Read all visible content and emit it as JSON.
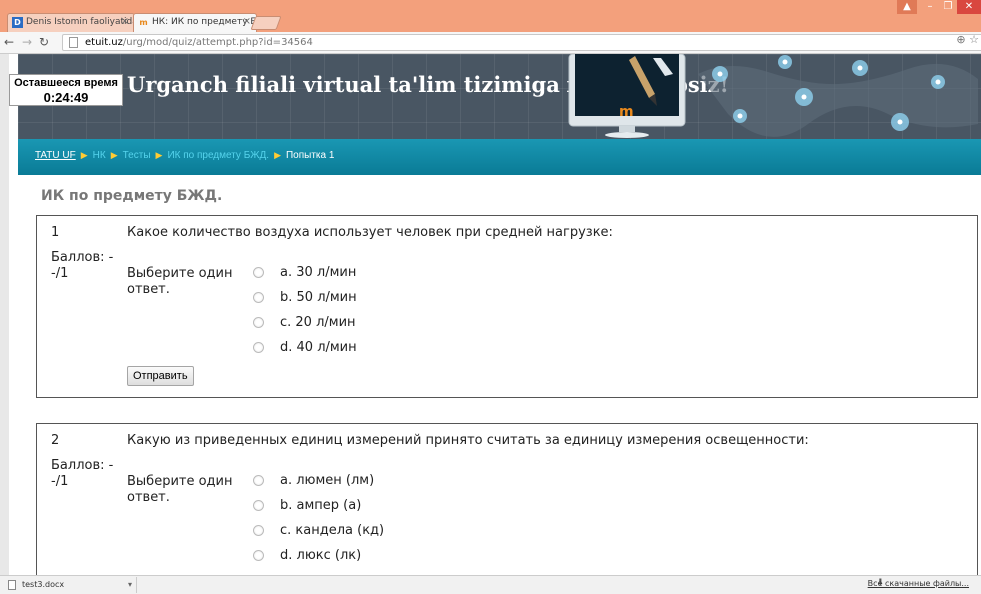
{
  "browser": {
    "tabs": [
      {
        "favicon": "D",
        "title": "Denis Istomin faoliyatida",
        "active": false
      },
      {
        "favicon": "m",
        "title": "НК: ИК по предмету БЖД",
        "active": true
      }
    ],
    "url_host": "etuit.uz",
    "url_path": "/urg/mod/quiz/attempt.php?id=34564"
  },
  "header": {
    "site_title": "Urganch filiali virtual ta'lim tizimiga xush kelibsiz!",
    "timer_label": "Оставшееся время",
    "timer_value": "0:24:49"
  },
  "breadcrumb": [
    "TATU UF",
    "НК",
    "Тесты",
    "ИК по предмету БЖД.",
    "Попытка 1"
  ],
  "quiz_title": "ИК по предмету БЖД.",
  "questions": [
    {
      "number": "1",
      "grade": "Баллов: --/1",
      "text": "Какое количество воздуха использует человек при средней нагрузке:",
      "prompt": "Выберите один ответ.",
      "answers": [
        "a. 30 л/мин",
        "b. 50 л/мин",
        "c. 20 л/мин",
        "d. 40 л/мин"
      ],
      "submit_label": "Отправить"
    },
    {
      "number": "2",
      "grade": "Баллов: --/1",
      "text": "Какую из приведенных единиц измерений принято считать за единицу измерения освещенности:",
      "prompt": "Выберите один ответ.",
      "answers": [
        "a. люмен (лм)",
        "b. ампер (а)",
        "c. кандела (кд)",
        "d. люкс (лк)"
      ]
    }
  ],
  "download_bar": {
    "file_name": "test3.docx",
    "show_all_label": "Все скачанные файлы..."
  },
  "icons": [
    "back-icon",
    "forward-icon",
    "reload-icon",
    "zoom-icon",
    "star-icon",
    "file-icon",
    "download-icon"
  ],
  "colors": {
    "tabbar": "#f3a07c",
    "header": "#495663",
    "navstrip": "#0a7b96",
    "breadcrumb_link": "#55d3ec",
    "breadcrumb_sep": "#ffcc33"
  }
}
